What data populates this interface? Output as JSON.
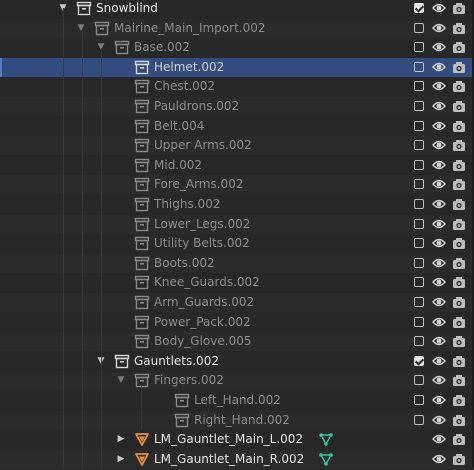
{
  "outliner": {
    "rows": [
      {
        "label": "Snowblind",
        "depth": 0,
        "arrow": "down",
        "icon": "collection-icon",
        "style": "bright",
        "exclude": "checked",
        "eye": true,
        "cam": true,
        "extra": null
      },
      {
        "label": "Mairine_Main_Import.002",
        "depth": 1,
        "arrow": "down",
        "icon": "collection-icon",
        "style": "dim",
        "exclude": "unchecked",
        "eye": true,
        "cam": true,
        "extra": null
      },
      {
        "label": "Base.002",
        "depth": 2,
        "arrow": "down",
        "icon": "collection-icon",
        "style": "dim",
        "exclude": "unchecked",
        "eye": true,
        "cam": true,
        "extra": null
      },
      {
        "label": "Helmet.002",
        "depth": 3,
        "arrow": null,
        "icon": "collection-icon",
        "style": "dim",
        "exclude": "unchecked",
        "eye": true,
        "cam": true,
        "extra": null,
        "selected": true
      },
      {
        "label": "Chest.002",
        "depth": 3,
        "arrow": null,
        "icon": "collection-icon",
        "style": "dim",
        "exclude": "unchecked",
        "eye": true,
        "cam": true,
        "extra": null
      },
      {
        "label": "Pauldrons.002",
        "depth": 3,
        "arrow": null,
        "icon": "collection-icon",
        "style": "dim",
        "exclude": "unchecked",
        "eye": true,
        "cam": true,
        "extra": null
      },
      {
        "label": "Belt.004",
        "depth": 3,
        "arrow": null,
        "icon": "collection-icon",
        "style": "dim",
        "exclude": "unchecked",
        "eye": true,
        "cam": true,
        "extra": null
      },
      {
        "label": "Upper Arms.002",
        "depth": 3,
        "arrow": null,
        "icon": "collection-icon",
        "style": "dim",
        "exclude": "unchecked",
        "eye": true,
        "cam": true,
        "extra": null
      },
      {
        "label": "Mid.002",
        "depth": 3,
        "arrow": null,
        "icon": "collection-icon",
        "style": "dim",
        "exclude": "unchecked",
        "eye": true,
        "cam": true,
        "extra": null
      },
      {
        "label": "Fore_Arms.002",
        "depth": 3,
        "arrow": null,
        "icon": "collection-icon",
        "style": "dim",
        "exclude": "unchecked",
        "eye": true,
        "cam": true,
        "extra": null
      },
      {
        "label": "Thighs.002",
        "depth": 3,
        "arrow": null,
        "icon": "collection-icon",
        "style": "dim",
        "exclude": "unchecked",
        "eye": true,
        "cam": true,
        "extra": null
      },
      {
        "label": "Lower_Legs.002",
        "depth": 3,
        "arrow": null,
        "icon": "collection-icon",
        "style": "dim",
        "exclude": "unchecked",
        "eye": true,
        "cam": true,
        "extra": null
      },
      {
        "label": "Utility Belts.002",
        "depth": 3,
        "arrow": null,
        "icon": "collection-icon",
        "style": "dim",
        "exclude": "unchecked",
        "eye": true,
        "cam": true,
        "extra": null
      },
      {
        "label": "Boots.002",
        "depth": 3,
        "arrow": null,
        "icon": "collection-icon",
        "style": "dim",
        "exclude": "unchecked",
        "eye": true,
        "cam": true,
        "extra": null
      },
      {
        "label": "Knee_Guards.002",
        "depth": 3,
        "arrow": null,
        "icon": "collection-icon",
        "style": "dim",
        "exclude": "unchecked",
        "eye": true,
        "cam": true,
        "extra": null
      },
      {
        "label": "Arm_Guards.002",
        "depth": 3,
        "arrow": null,
        "icon": "collection-icon",
        "style": "dim",
        "exclude": "unchecked",
        "eye": true,
        "cam": true,
        "extra": null
      },
      {
        "label": "Power_Pack.002",
        "depth": 3,
        "arrow": null,
        "icon": "collection-icon",
        "style": "dim",
        "exclude": "unchecked",
        "eye": true,
        "cam": true,
        "extra": null
      },
      {
        "label": "Body_Glove.005",
        "depth": 3,
        "arrow": null,
        "icon": "collection-icon",
        "style": "dim",
        "exclude": "unchecked",
        "eye": true,
        "cam": true,
        "extra": null
      },
      {
        "label": "Gauntlets.002",
        "depth": 2,
        "arrow": "down",
        "icon": "collection-icon",
        "style": "bright",
        "exclude": "checked",
        "eye": true,
        "cam": true,
        "extra": null
      },
      {
        "label": "Fingers.002",
        "depth": 3,
        "arrow": "down",
        "icon": "collection-icon",
        "style": "dim",
        "exclude": "unchecked",
        "eye": true,
        "cam": true,
        "extra": null
      },
      {
        "label": "Left_Hand.002",
        "depth": 4,
        "arrow": null,
        "icon": "collection-icon",
        "style": "dim",
        "exclude": "unchecked",
        "eye": true,
        "cam": true,
        "extra": null
      },
      {
        "label": "Right_Hand.002",
        "depth": 4,
        "arrow": null,
        "icon": "collection-icon",
        "style": "dim",
        "exclude": "unchecked",
        "eye": true,
        "cam": true,
        "extra": null
      },
      {
        "label": "LM_Gauntlet_Main_L.002",
        "depth": 3,
        "arrow": "right",
        "icon": "mesh-object-icon",
        "style": "bright",
        "exclude": null,
        "eye": true,
        "cam": true,
        "extra": "vertex-group-icon"
      },
      {
        "label": "LM_Gauntlet_Main_R.002",
        "depth": 3,
        "arrow": "right",
        "icon": "mesh-object-icon",
        "style": "bright",
        "exclude": null,
        "eye": true,
        "cam": true,
        "extra": "vertex-group-icon"
      }
    ]
  },
  "colors": {
    "selected_row": "#334d80",
    "object_orange": "#e8903a",
    "vertex_green": "#2fc8a0"
  }
}
